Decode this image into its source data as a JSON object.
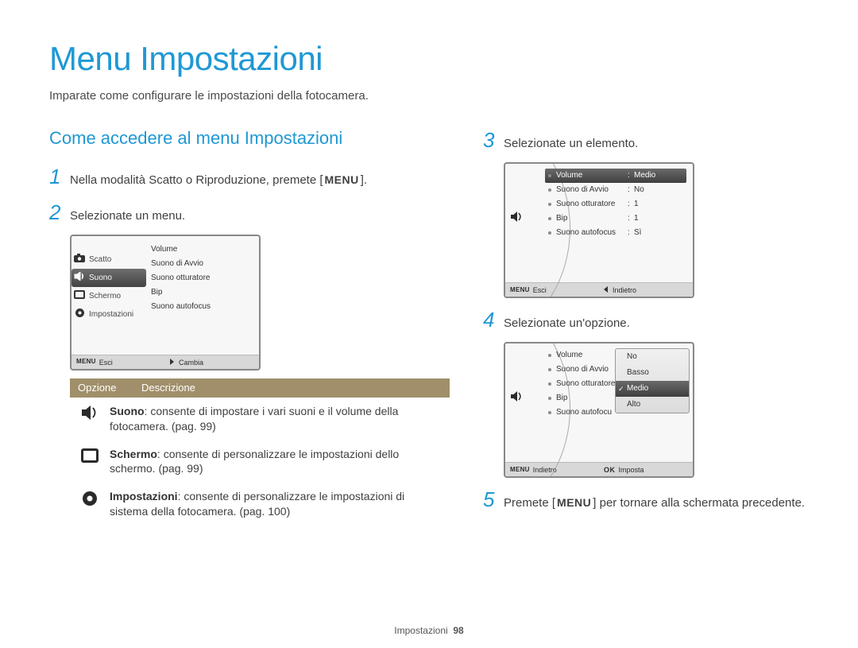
{
  "title": "Menu Impostazioni",
  "subtitle": "Imparate come configurare le impostazioni della fotocamera.",
  "section_title": "Come accedere al menu Impostazioni",
  "menu_word": "MENU",
  "ok_word": "OK",
  "steps": {
    "s1": "Nella modalità Scatto o Riproduzione, premete [",
    "s1b": "].",
    "s2": "Selezionate un menu.",
    "s3": "Selezionate un elemento.",
    "s4": "Selezionate un'opzione.",
    "s5a": "Premete [",
    "s5b": "] per tornare alla schermata precedente."
  },
  "screen1": {
    "left": [
      "Scatto",
      "Suono",
      "Schermo",
      "Impostazioni"
    ],
    "right": [
      "Volume",
      "Suono di Avvio",
      "Suono otturatore",
      "Bip",
      "Suono autofocus"
    ],
    "footer_left": "Esci",
    "footer_right": "Cambia"
  },
  "screen2": {
    "rows": [
      {
        "k": "Volume",
        "v": "Medio",
        "sel": true
      },
      {
        "k": "Suono di Avvio",
        "v": "No"
      },
      {
        "k": "Suono otturatore",
        "v": "1"
      },
      {
        "k": "Bip",
        "v": "1"
      },
      {
        "k": "Suono autofocus",
        "v": "Sì"
      }
    ],
    "footer_left": "Esci",
    "footer_right": "Indietro"
  },
  "screen3": {
    "rows": [
      {
        "k": "Volume"
      },
      {
        "k": "Suono di Avvio"
      },
      {
        "k": "Suono otturatore"
      },
      {
        "k": "Bip"
      },
      {
        "k": "Suono autofocu"
      }
    ],
    "popup": [
      "No",
      "Basso",
      "Medio",
      "Alto"
    ],
    "popup_selected": "Medio",
    "footer_left": "Indietro",
    "footer_right": "Imposta"
  },
  "options_table": {
    "header_option": "Opzione",
    "header_desc": "Descrizione",
    "rows": [
      {
        "bold": "Suono",
        "text": ": consente di impostare i vari suoni e il volume della fotocamera. (pag. 99)"
      },
      {
        "bold": "Schermo",
        "text": ": consente di personalizzare le impostazioni dello schermo. (pag. 99)"
      },
      {
        "bold": "Impostazioni",
        "text": ": consente di personalizzare le impostazioni di sistema della fotocamera. (pag. 100)"
      }
    ]
  },
  "footer": {
    "label": "Impostazioni",
    "page": "98"
  }
}
